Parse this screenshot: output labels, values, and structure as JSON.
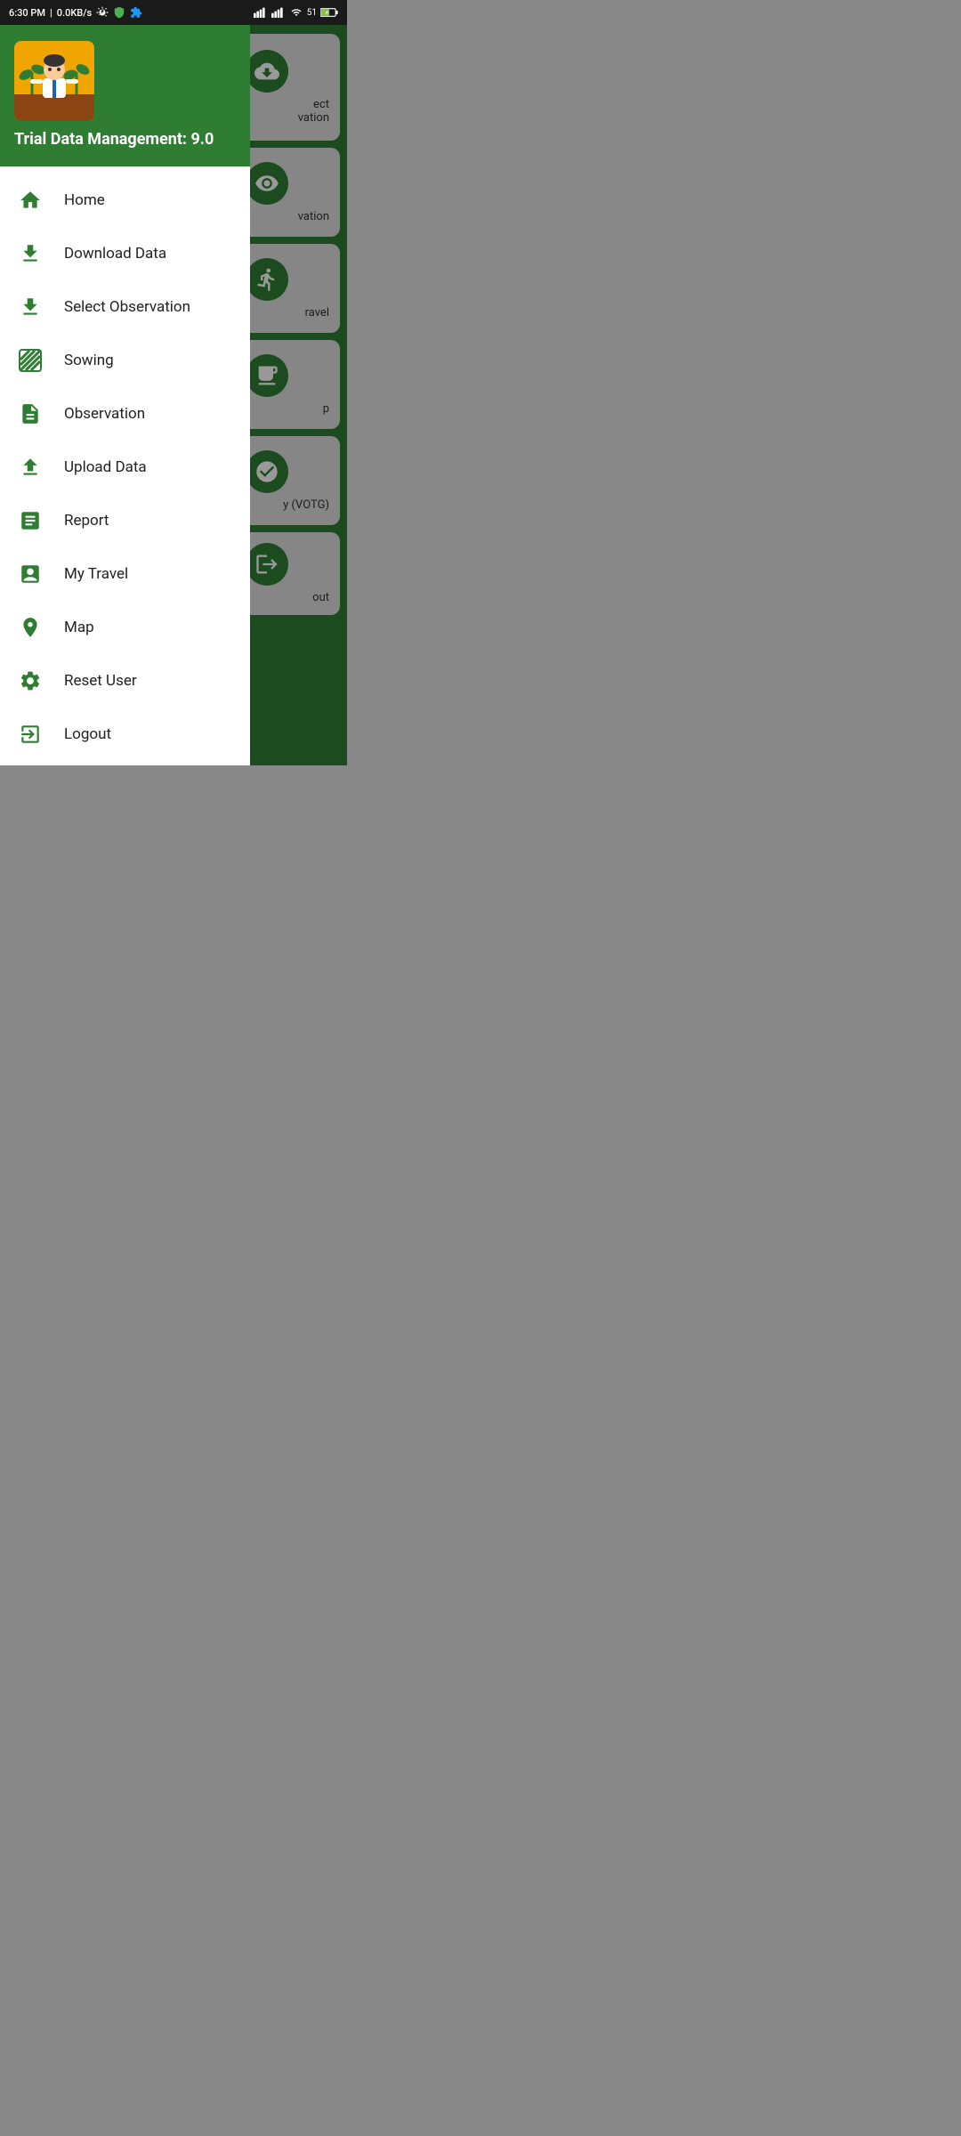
{
  "status_bar": {
    "time": "6:30 PM",
    "network_speed": "0.0KB/s",
    "battery_level": "51"
  },
  "app": {
    "title": "Trial Data Management: 9.0",
    "version": "9.0"
  },
  "drawer": {
    "app_name": "Trial Data Management: 9.0",
    "menu_items": [
      {
        "id": "home",
        "label": "Home",
        "icon": "home"
      },
      {
        "id": "download-data",
        "label": "Download Data",
        "icon": "download"
      },
      {
        "id": "select-observation",
        "label": "Select Observation",
        "icon": "download-circle"
      },
      {
        "id": "sowing",
        "label": "Sowing",
        "icon": "grid"
      },
      {
        "id": "observation",
        "label": "Observation",
        "icon": "file"
      },
      {
        "id": "upload-data",
        "label": "Upload Data",
        "icon": "upload"
      },
      {
        "id": "report",
        "label": "Report",
        "icon": "clipboard"
      },
      {
        "id": "my-travel",
        "label": "My Travel",
        "icon": "clipboard-list"
      },
      {
        "id": "map",
        "label": "Map",
        "icon": "map-pin"
      },
      {
        "id": "reset-user",
        "label": "Reset User",
        "icon": "gear"
      },
      {
        "id": "logout",
        "label": "Logout",
        "icon": "logout"
      }
    ]
  },
  "background_cards": [
    {
      "id": "select-observation-card",
      "text": "ect\nvation"
    },
    {
      "id": "observation-card",
      "text": "vation"
    },
    {
      "id": "my-travel-card",
      "text": "ravel"
    },
    {
      "id": "map-card",
      "text": "p"
    },
    {
      "id": "votg-card",
      "text": "y (VOTG)"
    },
    {
      "id": "out-card",
      "text": "out"
    }
  ],
  "colors": {
    "primary": "#2e7d32",
    "dark_green": "#1b5e20",
    "amber": "#f0a500",
    "white": "#ffffff"
  }
}
